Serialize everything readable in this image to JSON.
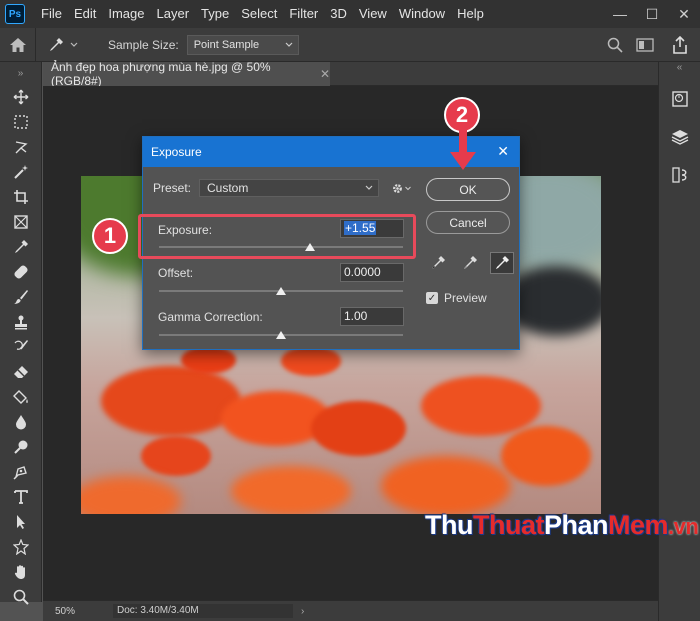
{
  "menubar": {
    "app_logo": "Ps",
    "items": [
      "File",
      "Edit",
      "Image",
      "Layer",
      "Type",
      "Select",
      "Filter",
      "3D",
      "View",
      "Window",
      "Help"
    ]
  },
  "window_controls": {
    "minimize": "—",
    "maximize": "☐",
    "close": "✕"
  },
  "options_bar": {
    "sample_size_label": "Sample Size:",
    "sample_size_value": "Point Sample"
  },
  "document": {
    "tab_title": "Ảnh đẹp hoa phượng mùa hè.jpg @ 50% (RGB/8#)",
    "tab_close": "✕"
  },
  "status_bar": {
    "zoom": "50%",
    "doc_size": "Doc: 3.40M/3.40M",
    "arrow": "›"
  },
  "dialog": {
    "title": "Exposure",
    "close": "✕",
    "preset_label": "Preset:",
    "preset_value": "Custom",
    "exposure_label": "Exposure:",
    "exposure_value": "+1.55",
    "exposure_slider": 0.62,
    "offset_label": "Offset:",
    "offset_value": "0.0000",
    "offset_slider": 0.5,
    "gamma_label": "Gamma Correction:",
    "gamma_value": "1.00",
    "gamma_slider": 0.5,
    "ok_label": "OK",
    "cancel_label": "Cancel",
    "preview_label": "Preview",
    "preview_checked": true
  },
  "annotations": {
    "step1": "1",
    "step2": "2",
    "accent_color": "#e63b4c"
  },
  "watermark": {
    "part1": "Thu",
    "part2": "Thuat",
    "part3": "Phan",
    "part4": "Mem",
    "suffix": ".vn"
  },
  "colors": {
    "dialog_title": "#1873d2",
    "ui_dark": "#323232",
    "panel": "#3c3c3c"
  }
}
